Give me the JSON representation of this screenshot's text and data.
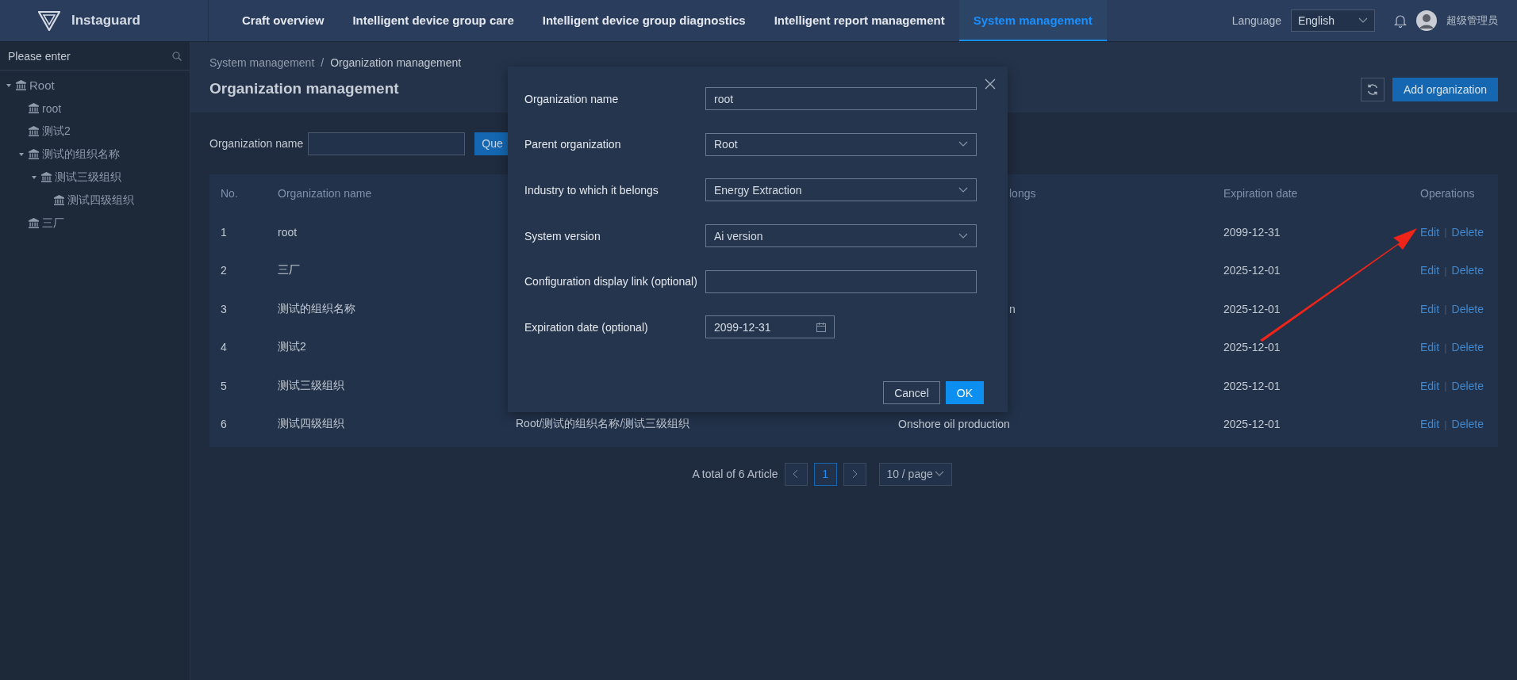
{
  "header": {
    "logo": "Instaguard",
    "nav": [
      {
        "label": "Craft overview",
        "selected": false
      },
      {
        "label": "Intelligent device group care",
        "selected": false
      },
      {
        "label": "Intelligent device group diagnostics",
        "selected": false
      },
      {
        "label": "Intelligent report management",
        "selected": false
      },
      {
        "label": "System management",
        "selected": true
      }
    ],
    "language_label": "Language",
    "language": "English",
    "user": "超级管理员"
  },
  "sidebar": {
    "search_placeholder": "Please enter",
    "tree": [
      {
        "label": "Root",
        "expanded": true,
        "children": [
          {
            "label": "root"
          },
          {
            "label": "测试2"
          },
          {
            "label": "测试的组织名称",
            "expanded": true,
            "children": [
              {
                "label": "测试三级组织",
                "expanded": true,
                "children": [
                  {
                    "label": "测试四级组织"
                  }
                ]
              }
            ]
          },
          {
            "label": "三厂"
          }
        ]
      }
    ]
  },
  "page": {
    "breadcrumb": [
      "System management",
      "Organization management"
    ],
    "breadcrumb_separator": "/",
    "title": "Organization management",
    "add_button": "Add organization"
  },
  "filter": {
    "label": "Organization name",
    "query_button": "Que"
  },
  "table": {
    "columns": [
      {
        "label": "No."
      },
      {
        "label": "Organization name"
      },
      {},
      {
        "label": "longs",
        "clipped": true
      },
      {
        "label": "Expiration date"
      },
      {
        "label": "Operations"
      }
    ],
    "action_separator": "|",
    "rows": [
      {
        "no": "1",
        "name": "root",
        "expiration": "2099-12-31",
        "actions": [
          "Edit",
          "Delete"
        ]
      },
      {
        "no": "2",
        "name": "三厂",
        "expiration": "2025-12-01",
        "actions": [
          "Edit",
          "Delete"
        ]
      },
      {
        "no": "3",
        "name": "测试的组织名称",
        "column_4": {
          "text": "n",
          "clipped": true
        },
        "expiration": "2025-12-01",
        "actions": [
          "Edit",
          "Delete"
        ]
      },
      {
        "no": "4",
        "name": "测试2",
        "expiration": "2025-12-01",
        "actions": [
          "Edit",
          "Delete"
        ]
      },
      {
        "no": "5",
        "name": "测试三级组织",
        "expiration": "2025-12-01",
        "actions": [
          "Edit",
          "Delete"
        ]
      },
      {
        "no": "6",
        "name": "测试四级组织",
        "column_3": "Root/测试的组织名称/测试三级组织",
        "column_4": {
          "text": "Onshore oil production",
          "clipped": false
        },
        "expiration": "2025-12-01",
        "actions": [
          "Edit",
          "Delete"
        ]
      }
    ]
  },
  "pagination": {
    "total": "A total of 6 Article",
    "pages": [
      {
        "label": "1",
        "selected": true
      }
    ],
    "page_size": "10 / page"
  },
  "modal": {
    "fields": [
      {
        "kind": "text",
        "label": "Organization name",
        "value": "root"
      },
      {
        "kind": "select",
        "label": "Parent organization",
        "value": "Root"
      },
      {
        "kind": "select",
        "label": "Industry to which it belongs",
        "value": "Energy Extraction"
      },
      {
        "kind": "select",
        "label": "System version",
        "value": "Ai version"
      },
      {
        "kind": "text",
        "label": "Configuration display link (optional)"
      },
      {
        "kind": "date",
        "label": "Expiration date (optional)",
        "value": "2099-12-31"
      }
    ],
    "cancel": "Cancel",
    "ok": "OK"
  }
}
